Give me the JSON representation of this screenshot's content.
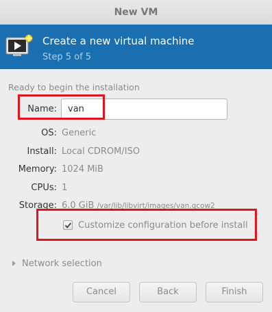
{
  "window": {
    "title": "New VM"
  },
  "header": {
    "icon": "vm-monitor-icon",
    "title": "Create a new virtual machine",
    "step": "Step 5 of 5",
    "accent_color": "#1a6fb0"
  },
  "summary": {
    "heading": "Ready to begin the installation",
    "name_label": "Name:",
    "name_value": "van",
    "os_label": "OS:",
    "os_value": "Generic",
    "install_label": "Install:",
    "install_value": "Local CDROM/ISO",
    "memory_label": "Memory:",
    "memory_value": "1024 MiB",
    "cpus_label": "CPUs:",
    "cpus_value": "1",
    "storage_label": "Storage:",
    "storage_size": "6.0 GiB",
    "storage_path": "/var/lib/libvirt/images/van.qcow2"
  },
  "options": {
    "customize_label": "Customize configuration before install",
    "customize_checked": true
  },
  "network": {
    "label": "Network selection",
    "expanded": false
  },
  "buttons": {
    "cancel": "Cancel",
    "back": "Back",
    "finish": "Finish"
  },
  "annotation_color": "#e0141e"
}
